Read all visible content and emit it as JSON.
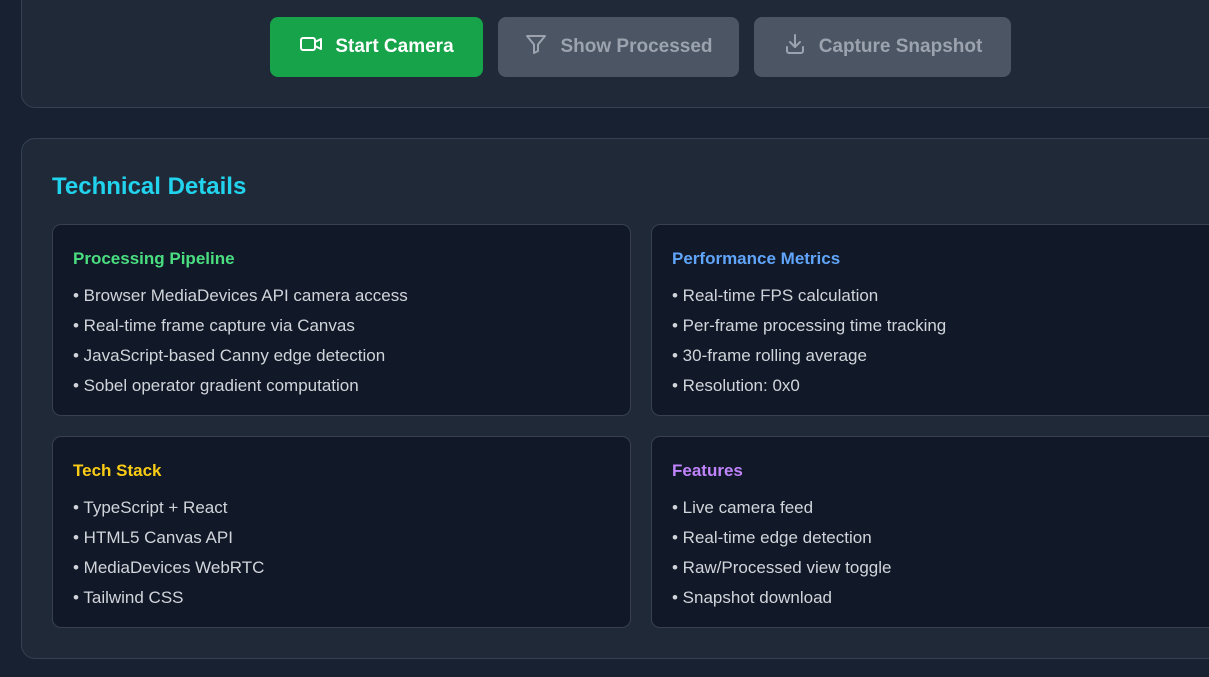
{
  "controls": {
    "start_camera": "Start Camera",
    "show_processed": "Show Processed",
    "capture_snapshot": "Capture Snapshot"
  },
  "details": {
    "title": "Technical Details",
    "cards": [
      {
        "title": "Processing Pipeline",
        "color": "#4ade80",
        "items": [
          "• Browser MediaDevices API camera access",
          "• Real-time frame capture via Canvas",
          "• JavaScript-based Canny edge detection",
          "• Sobel operator gradient computation"
        ]
      },
      {
        "title": "Performance Metrics",
        "color": "#60a5fa",
        "items": [
          "• Real-time FPS calculation",
          "• Per-frame processing time tracking",
          "• 30-frame rolling average",
          "• Resolution: 0x0"
        ]
      },
      {
        "title": "Tech Stack",
        "color": "#facc15",
        "items": [
          "• TypeScript + React",
          "• HTML5 Canvas API",
          "• MediaDevices WebRTC",
          "• Tailwind CSS"
        ]
      },
      {
        "title": "Features",
        "color": "#c084fc",
        "items": [
          "• Live camera feed",
          "• Real-time edge detection",
          "• Raw/Processed view toggle",
          "• Snapshot download"
        ]
      }
    ]
  },
  "icons": {
    "start": "video-camera-icon",
    "processed": "filter-icon",
    "snapshot": "download-icon"
  }
}
